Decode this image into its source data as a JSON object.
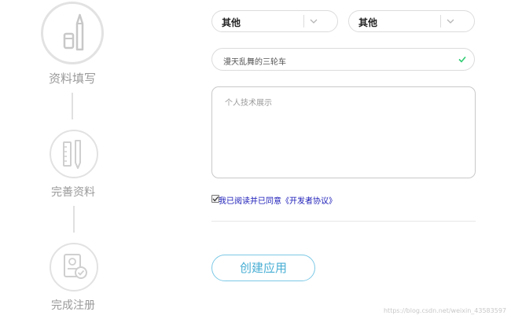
{
  "steps": [
    {
      "label": "资料填写",
      "icon": "pencil-icon"
    },
    {
      "label": "完善资料",
      "icon": "ruler-pen-icon"
    },
    {
      "label": "完成注册",
      "icon": "document-check-icon"
    }
  ],
  "form": {
    "select_1": {
      "value": "其他"
    },
    "select_2": {
      "value": "其他"
    },
    "name_input": {
      "value": "漫天乱舞的三轮车",
      "status_icon": "check-icon"
    },
    "description": {
      "placeholder": "个人技术展示"
    },
    "agreement": {
      "checked": true,
      "label": "我已阅读并已同意《开发者协议》"
    },
    "create_button": "创建应用"
  },
  "watermark": "https://blog.csdn.net/weixin_43583597",
  "colors": {
    "accent": "#48aed4",
    "check": "#2ecc71",
    "link": "#1a1ab8",
    "step_gray": "#e2e2e2"
  }
}
